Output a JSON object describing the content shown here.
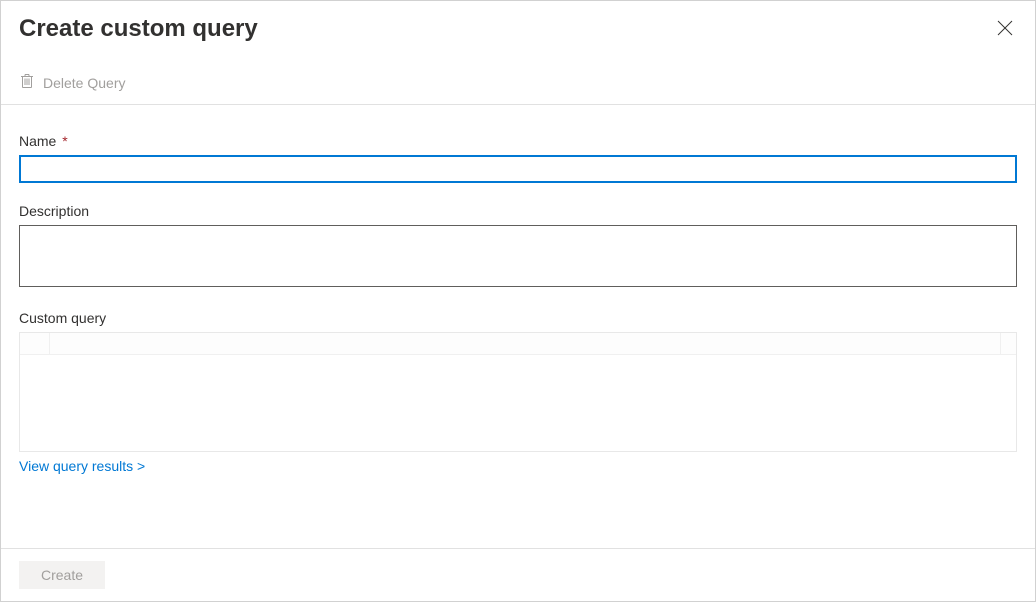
{
  "header": {
    "title": "Create custom query"
  },
  "toolbar": {
    "delete_label": "Delete Query"
  },
  "fields": {
    "name": {
      "label": "Name",
      "required_marker": "*",
      "value": ""
    },
    "description": {
      "label": "Description",
      "value": ""
    },
    "custom_query": {
      "label": "Custom query",
      "value": ""
    }
  },
  "links": {
    "view_results": "View query results >"
  },
  "footer": {
    "create_label": "Create"
  }
}
